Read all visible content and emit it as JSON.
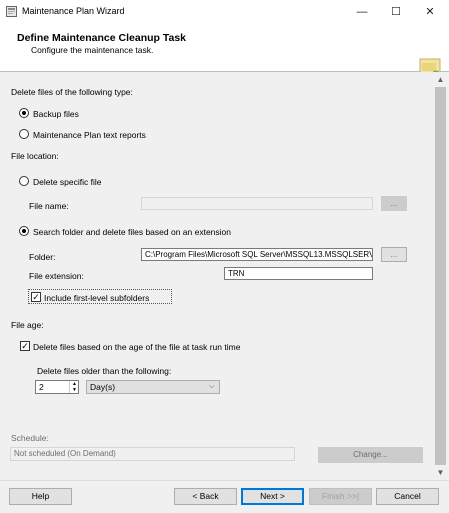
{
  "window": {
    "title": "Maintenance Plan Wizard",
    "minimize_glyph": "—",
    "maximize_glyph": "☐",
    "close_glyph": "✕"
  },
  "header": {
    "title": "Define Maintenance Cleanup Task",
    "subtitle": "Configure the maintenance task."
  },
  "delete_type": {
    "label": "Delete files of the following type:",
    "options": [
      {
        "label": "Backup files",
        "selected": true
      },
      {
        "label": "Maintenance Plan text reports",
        "selected": false
      }
    ]
  },
  "file_location": {
    "label": "File location:",
    "specific_file": {
      "label": "Delete specific file",
      "selected": false,
      "file_name_label": "File name:",
      "file_name_value": "",
      "browse_label": "..."
    },
    "search_folder": {
      "label": "Search folder and delete files based on an extension",
      "selected": true,
      "folder_label": "Folder:",
      "folder_value": "C:\\Program Files\\Microsoft SQL Server\\MSSQL13.MSSQLSERV",
      "browse_label": "...",
      "extension_label": "File extension:",
      "extension_value": "TRN",
      "include_subfolders_label": "Include first-level subfolders",
      "include_subfolders_checked": true
    }
  },
  "file_age": {
    "label": "File age:",
    "delete_by_age_label": "Delete files based on the age of the file at task run time",
    "delete_by_age_checked": true,
    "older_than_label": "Delete files older than the following:",
    "amount": "2",
    "unit": "Day(s)"
  },
  "schedule": {
    "label": "Schedule:",
    "value": "Not scheduled (On Demand)",
    "change_label": "Change..."
  },
  "footer": {
    "help": "Help",
    "back": "< Back",
    "next": "Next >",
    "finish": "Finish >>|",
    "cancel": "Cancel"
  },
  "colors": {
    "accent": "#0078d7",
    "background": "#f0f0f0"
  },
  "icons": {
    "app": "wizard-app-icon",
    "header": "maintenance-graphic-icon"
  }
}
